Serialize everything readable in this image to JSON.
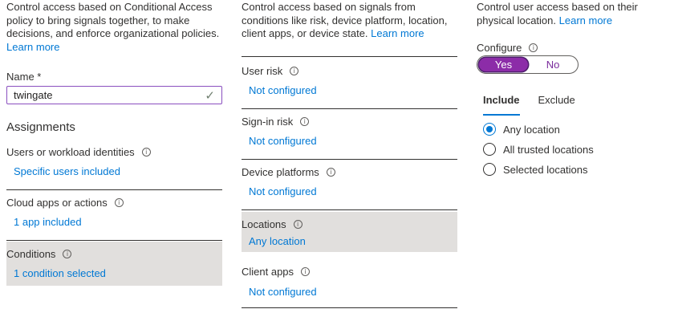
{
  "col1": {
    "description": "Control access based on Conditional Access policy to bring signals together, to make decisions, and enforce organizational policies.",
    "learn_more": "Learn more",
    "name_label": "Name *",
    "name_value": "twingate",
    "assignments_heading": "Assignments",
    "sections": [
      {
        "label": "Users or workload identities",
        "value": "Specific users included"
      },
      {
        "label": "Cloud apps or actions",
        "value": "1 app included"
      },
      {
        "label": "Conditions",
        "value": "1 condition selected"
      }
    ]
  },
  "col2": {
    "description": "Control access based on signals from conditions like risk, device platform, location, client apps, or device state.",
    "learn_more": "Learn more",
    "sections": [
      {
        "label": "User risk",
        "value": "Not configured"
      },
      {
        "label": "Sign-in risk",
        "value": "Not configured"
      },
      {
        "label": "Device platforms",
        "value": "Not configured"
      },
      {
        "label": "Locations",
        "value": "Any location"
      },
      {
        "label": "Client apps",
        "value": "Not configured"
      }
    ]
  },
  "col3": {
    "description": "Control user access based on their physical location.",
    "learn_more": "Learn more",
    "configure_label": "Configure",
    "toggle": {
      "yes": "Yes",
      "no": "No",
      "selected": "Yes"
    },
    "tabs": [
      "Include",
      "Exclude"
    ],
    "active_tab": "Include",
    "options": [
      "Any location",
      "All trusted locations",
      "Selected locations"
    ],
    "selected_option": "Any location"
  },
  "colors": {
    "accent": "#0078d4",
    "toggle_on": "#8c2ca8",
    "active_section_bg": "#e1dfdd"
  }
}
